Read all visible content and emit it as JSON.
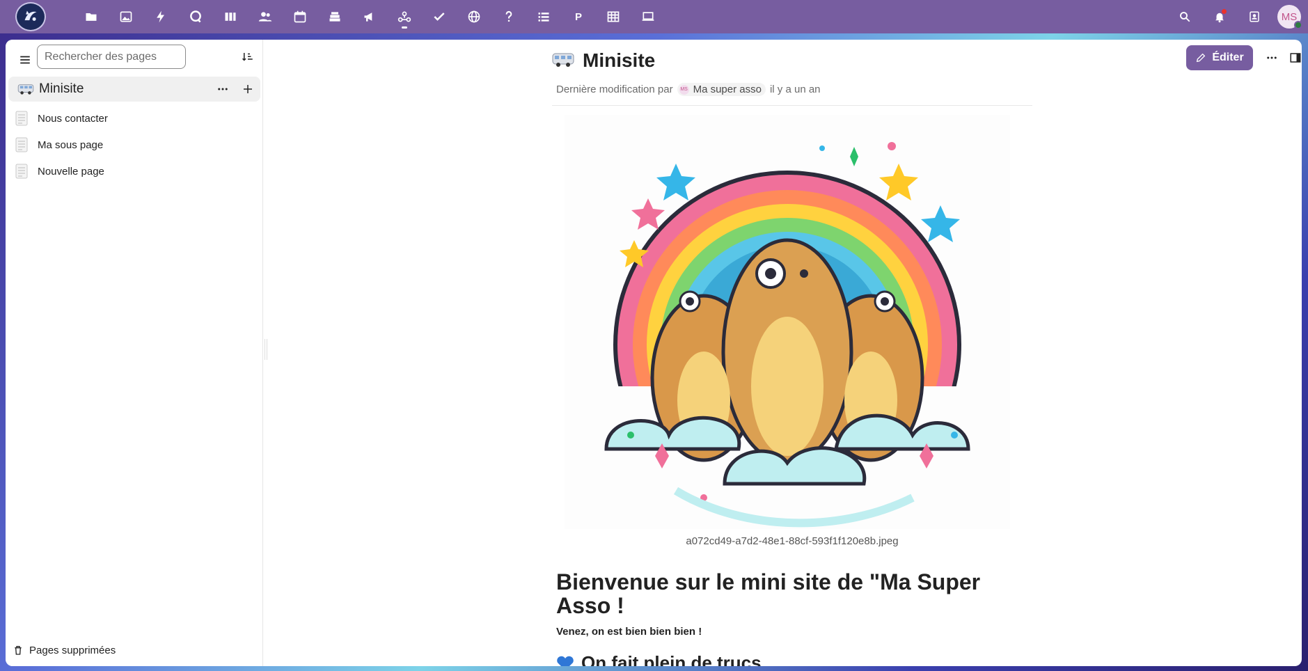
{
  "topbar": {
    "apps": [
      {
        "icon": "folder-icon"
      },
      {
        "icon": "image-icon"
      },
      {
        "icon": "bolt-icon"
      },
      {
        "icon": "chat-bubble-icon"
      },
      {
        "icon": "deck-columns-icon"
      },
      {
        "icon": "contacts-icon"
      },
      {
        "icon": "calendar-icon"
      },
      {
        "icon": "stack-icon"
      },
      {
        "icon": "megaphone-icon"
      },
      {
        "icon": "collectives-icon"
      },
      {
        "icon": "check-icon"
      },
      {
        "icon": "globe-icon"
      },
      {
        "icon": "help-icon"
      },
      {
        "icon": "list-icon"
      },
      {
        "icon": "polls-icon",
        "label": "P"
      },
      {
        "icon": "table-icon"
      },
      {
        "icon": "laptop-icon"
      }
    ],
    "avatar_initials": "MS"
  },
  "sidebar": {
    "search_placeholder": "Rechercher des pages",
    "root": {
      "emoji": "minibus-emoji",
      "title": "Minisite"
    },
    "pages": [
      {
        "title": "Nous contacter"
      },
      {
        "title": "Ma sous page"
      },
      {
        "title": "Nouvelle page"
      }
    ],
    "trash_label": "Pages supprimées"
  },
  "page": {
    "title": "Minisite",
    "last_modified_prefix": "Dernière modification par",
    "last_modified_user": "Ma super asso",
    "last_modified_user_initials": "MS",
    "last_modified_time": "il y a un an",
    "edit_label": "Éditer",
    "image_caption": "a072cd49-a7d2-48e1-88cf-593f1f120e8b.jpeg",
    "heading": "Bienvenue sur le mini site de \"Ma Super Asso !",
    "subtitle": "Venez, on est bien bien bien !",
    "section_heading": "On fait plein de trucs"
  },
  "colors": {
    "accent": "#775da0",
    "topbar": "#775da0"
  }
}
